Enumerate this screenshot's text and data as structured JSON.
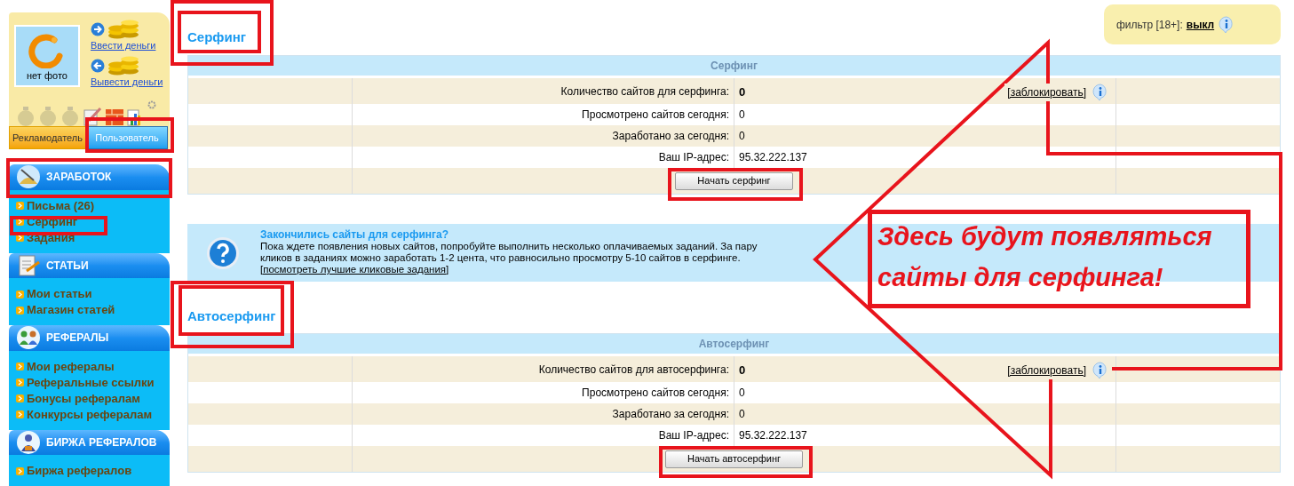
{
  "user_card": {
    "avatar_caption": "нет фото",
    "links": [
      "Ввести деньги",
      "Вывести деньги"
    ],
    "tabs": [
      {
        "label": "Рекламодатель",
        "selected": false
      },
      {
        "label": "Пользователь",
        "selected": true
      }
    ]
  },
  "menu": [
    {
      "title": "ЗАРАБОТОК",
      "items": [
        "Письма (26)",
        "Серфинг",
        "Задания"
      ]
    },
    {
      "title": "СТАТЬИ",
      "items": [
        "Мои статьи",
        "Магазин статей"
      ]
    },
    {
      "title": "РЕФЕРАЛЫ",
      "items": [
        "Мои рефералы",
        "Реферальные ссылки",
        "Бонусы рефералам",
        "Конкурсы рефералам"
      ]
    },
    {
      "title": "БИРЖА РЕФЕРАЛОВ",
      "items": [
        "Биржа рефералов"
      ]
    }
  ],
  "filter": {
    "label": "фильтр [18+]:",
    "value": "выкл"
  },
  "content": [
    {
      "kind": "section",
      "heading": "Серфинг",
      "table_title": "Серфинг",
      "rows": [
        {
          "label": "Количество сайтов для серфинга:",
          "value": "0",
          "bold": true,
          "action": "[заблокировать]"
        },
        {
          "label": "Просмотрено сайтов сегодня:",
          "value": "0",
          "bold": false
        },
        {
          "label": "Заработано за сегодня:",
          "value": "0",
          "bold": false
        },
        {
          "label": "Ваш IP-адрес:",
          "value": "95.32.222.137",
          "bold": false
        }
      ],
      "button": "Начать серфинг"
    },
    {
      "kind": "notice",
      "title": "Закончились сайты для серфинга?",
      "text": "Пока ждете появления новых сайтов, попробуйте выполнить несколько оплачиваемых заданий. За пару кликов в заданиях можно заработать 1-2 цента, что равносильно просмотру 5-10 сайтов в серфинге.",
      "link": "[посмотреть лучшие кликовые задания]"
    },
    {
      "kind": "section",
      "heading": "Автосерфинг",
      "table_title": "Автосерфинг",
      "rows": [
        {
          "label": "Количество сайтов для автосерфинга:",
          "value": "0",
          "bold": true,
          "action": "[заблокировать]"
        },
        {
          "label": "Просмотрено сайтов сегодня:",
          "value": "0",
          "bold": false
        },
        {
          "label": "Заработано за сегодня:",
          "value": "0",
          "bold": false
        },
        {
          "label": "Ваш IP-адрес:",
          "value": "95.32.222.137",
          "bold": false
        }
      ],
      "button": "Начать автосерфинг"
    }
  ],
  "annotation": {
    "callout": "Здесь будут появляться сайты для серфинга!"
  }
}
